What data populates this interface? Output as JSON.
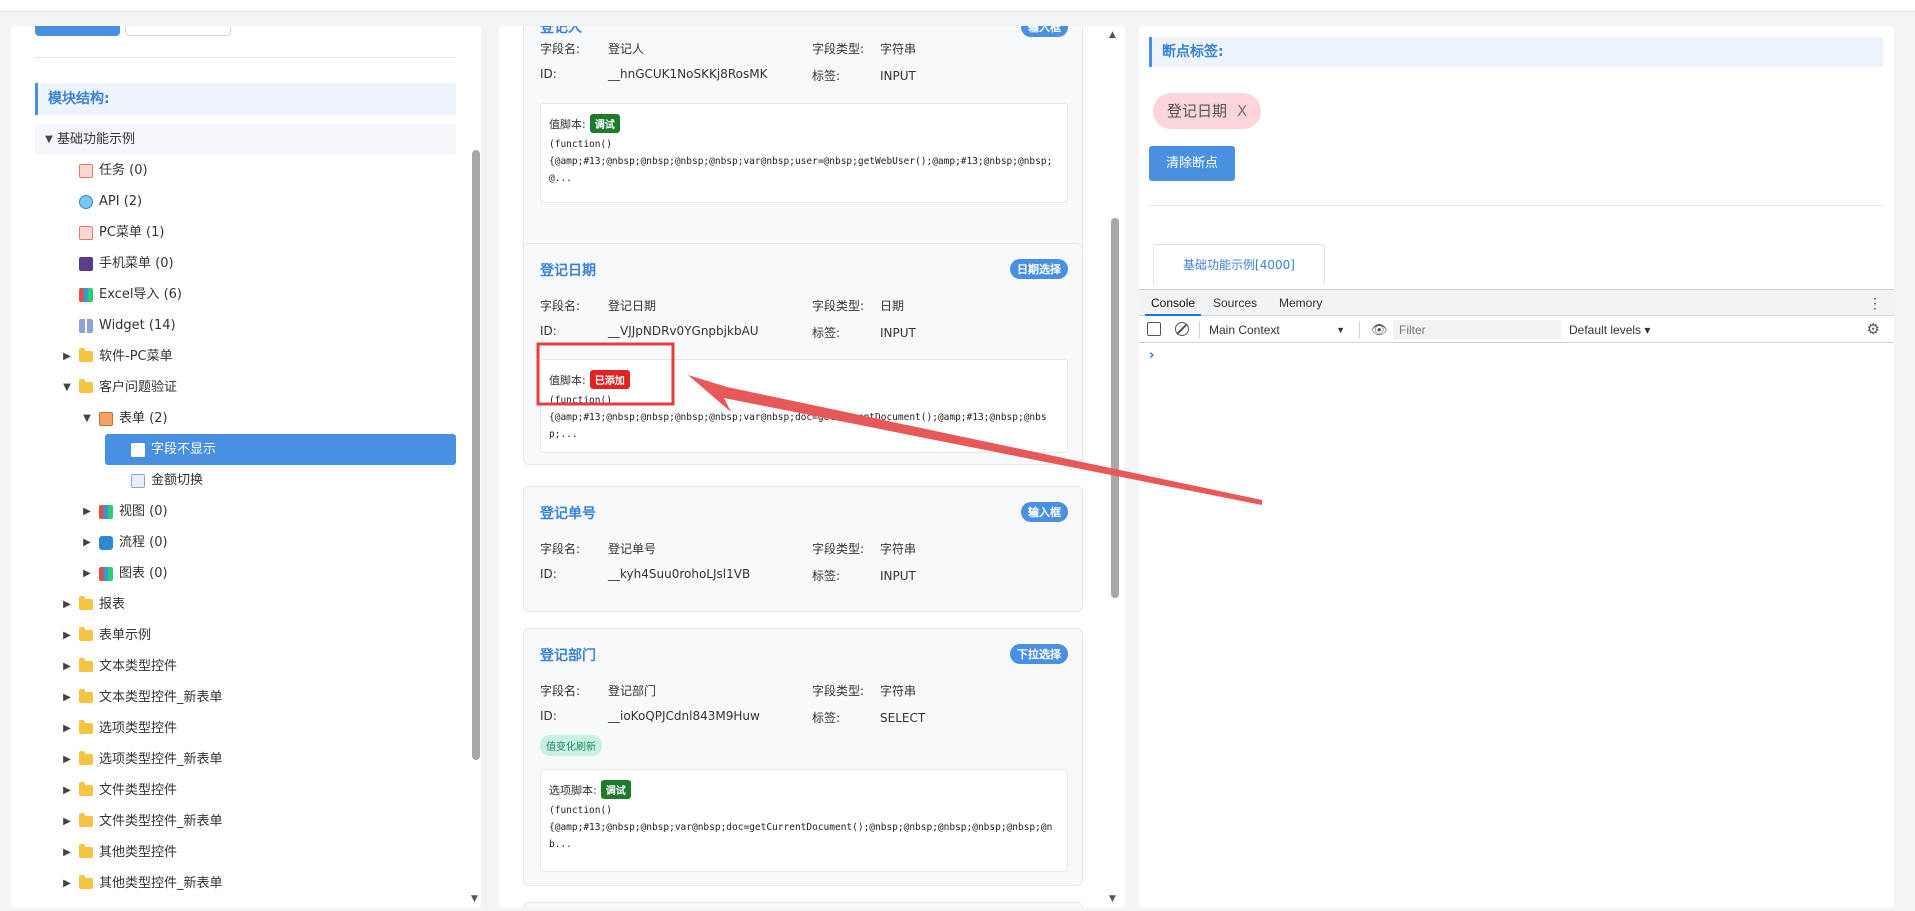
{
  "module_panel": {
    "section_title": "模块结构:",
    "tree": [
      {
        "label": "基础功能示例",
        "arrow": "▼",
        "icon": "none",
        "indent": 0,
        "root": true
      },
      {
        "label": "任务 (0)",
        "arrow": "",
        "icon": "doc-icon",
        "indent": 1
      },
      {
        "label": "API (2)",
        "arrow": "",
        "icon": "globe-icon",
        "indent": 1
      },
      {
        "label": "PC菜单 (1)",
        "arrow": "",
        "icon": "doc-icon",
        "indent": 1
      },
      {
        "label": "手机菜单 (0)",
        "arrow": "",
        "icon": "phone-icon",
        "indent": 1
      },
      {
        "label": "Excel导入 (6)",
        "arrow": "",
        "icon": "chart-icon",
        "indent": 1
      },
      {
        "label": "Widget (14)",
        "arrow": "",
        "icon": "grid-icon",
        "indent": 1
      },
      {
        "label": "软件-PC菜单",
        "arrow": "▶",
        "icon": "folder-icon",
        "indent": 1
      },
      {
        "label": "客户问题验证",
        "arrow": "▼",
        "icon": "folder-icon",
        "indent": 1
      },
      {
        "label": "表单 (2)",
        "arrow": "▼",
        "icon": "form-icon",
        "indent": 2
      },
      {
        "label": "字段不显示",
        "arrow": "",
        "icon": "page-icon",
        "indent": 3,
        "selected": true
      },
      {
        "label": "金额切换",
        "arrow": "",
        "icon": "page-icon",
        "indent": 3
      },
      {
        "label": "视图 (0)",
        "arrow": "▶",
        "icon": "chart-icon",
        "indent": 2
      },
      {
        "label": "流程 (0)",
        "arrow": "▶",
        "icon": "flow-icon",
        "indent": 2
      },
      {
        "label": "图表 (0)",
        "arrow": "▶",
        "icon": "chart-icon",
        "indent": 2
      },
      {
        "label": "报表",
        "arrow": "▶",
        "icon": "folder-icon",
        "indent": 1
      },
      {
        "label": "表单示例",
        "arrow": "▶",
        "icon": "folder-icon",
        "indent": 1
      },
      {
        "label": "文本类型控件",
        "arrow": "▶",
        "icon": "folder-icon",
        "indent": 1
      },
      {
        "label": "文本类型控件_新表单",
        "arrow": "▶",
        "icon": "folder-icon",
        "indent": 1
      },
      {
        "label": "选项类型控件",
        "arrow": "▶",
        "icon": "folder-icon",
        "indent": 1
      },
      {
        "label": "选项类型控件_新表单",
        "arrow": "▶",
        "icon": "folder-icon",
        "indent": 1
      },
      {
        "label": "文件类型控件",
        "arrow": "▶",
        "icon": "folder-icon",
        "indent": 1
      },
      {
        "label": "文件类型控件_新表单",
        "arrow": "▶",
        "icon": "folder-icon",
        "indent": 1
      },
      {
        "label": "其他类型控件",
        "arrow": "▶",
        "icon": "folder-icon",
        "indent": 1
      },
      {
        "label": "其他类型控件_新表单",
        "arrow": "▶",
        "icon": "folder-icon",
        "indent": 1
      }
    ]
  },
  "fields": {
    "labels": {
      "field_name": "字段名:",
      "id": "ID:",
      "field_type": "字段类型:",
      "tag": "标签:"
    },
    "cards": [
      {
        "title": "登记人",
        "badge": "输入框",
        "field_name": "登记人",
        "id": "__hnGCUK1NoSKKj8RosMK",
        "field_type": "字符串",
        "tag": "INPUT",
        "script_label": "值脚本:",
        "script_tag": "调试",
        "code": "(function()\n{@amp;#13;@nbsp;@nbsp;@nbsp;@nbsp;var@nbsp;user=@nbsp;getWebUser();@amp;#13;@nbsp;@nbsp;@..."
      },
      {
        "title": "登记日期",
        "badge": "日期选择",
        "field_name": "登记日期",
        "id": "__VJJpNDRv0YGnpbjkbAU",
        "field_type": "日期",
        "tag": "INPUT",
        "script_label": "值脚本:",
        "script_tag": "已添加",
        "code": "(function()\n{@amp;#13;@nbsp;@nbsp;@nbsp;@nbsp;var@nbsp;doc=getCurrentDocument();@amp;#13;@nbsp;@nbsp;..."
      },
      {
        "title": "登记单号",
        "badge": "输入框",
        "field_name": "登记单号",
        "id": "__kyh4Suu0rohoLJsl1VB",
        "field_type": "字符串",
        "tag": "INPUT"
      },
      {
        "title": "登记部门",
        "badge": "下拉选择",
        "field_name": "登记部门",
        "id": "__ioKoQPJCdnl843M9Huw",
        "field_type": "字符串",
        "tag": "SELECT",
        "pill": "值变化刷新",
        "script_label": "选项脚本:",
        "script_tag": "调试",
        "code": "(function()\n{@amp;#13;@nbsp;@nbsp;var@nbsp;doc=getCurrentDocument();@nbsp;@nbsp;@nbsp;@nbsp;@nbsp;@nb..."
      }
    ]
  },
  "breakpoints": {
    "title": "断点标签:",
    "chip_label": "登记日期",
    "chip_close": "X",
    "clear_button": "清除断点",
    "module_tab": "基础功能示例[4000]"
  },
  "devtools": {
    "tabs": [
      "Console",
      "Sources",
      "Memory"
    ],
    "active_tab": "Console",
    "context": "Main Context",
    "filter_placeholder": "Filter",
    "levels": "Default levels ▾",
    "prompt": "›"
  },
  "colors": {
    "accent": "#4a90e2",
    "annotation": "#e53e3e",
    "debug_tag": "#1e7b2e",
    "added_tag": "#e02424",
    "chip_bg": "#fbd5d9"
  }
}
